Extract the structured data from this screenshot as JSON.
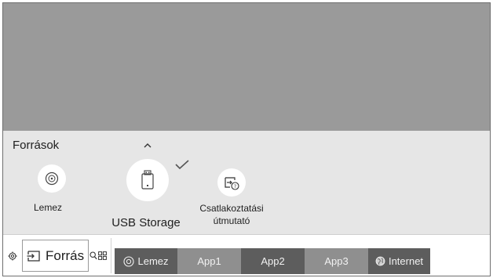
{
  "panel": {
    "title": "Források"
  },
  "sources": [
    {
      "label": "Lemez",
      "icon": "disc-icon"
    },
    {
      "label": "USB Storage",
      "icon": "usb-drive-icon",
      "selected": true
    },
    {
      "label_line1": "Csatlakoztatási",
      "label_line2": "útmutató",
      "icon": "connection-guide-icon"
    }
  ],
  "bottom_bar": {
    "source_label": "Forrás",
    "tiles": [
      {
        "label": "Lemez",
        "icon": "disc-icon"
      },
      {
        "label": "App1"
      },
      {
        "label": "App2"
      },
      {
        "label": "App3"
      },
      {
        "label": "Internet",
        "icon": "globe-icon"
      }
    ]
  },
  "colors": {
    "tv_background": "#9a9a9a",
    "panel_background": "#e6e6e6",
    "tile_dark": "#5d5d5d",
    "tile_light": "#8f8f8f"
  }
}
